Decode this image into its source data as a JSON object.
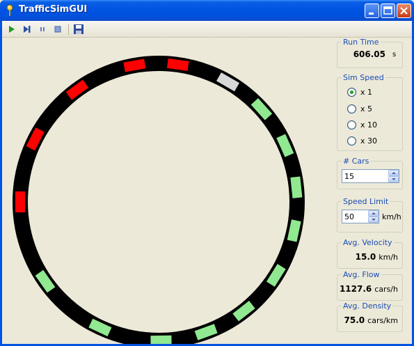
{
  "window": {
    "title": "TrafficSimGUI",
    "icon": "pin-icon"
  },
  "toolbar": {
    "items": [
      {
        "name": "play",
        "icon": "play-icon"
      },
      {
        "name": "step",
        "icon": "step-forward-icon"
      },
      {
        "name": "pause",
        "icon": "pause-icon"
      },
      {
        "name": "stop",
        "icon": "stop-icon"
      },
      {
        "name": "save",
        "icon": "save-icon"
      }
    ]
  },
  "colors": {
    "road": "#000000",
    "car_fast": "#90e890",
    "car_slow": "#ff0000",
    "car_mid": "#d8d8d8",
    "background": "#ece9d8",
    "group_label": "#1a4cb4"
  },
  "track": {
    "cars": [
      {
        "angle_deg": -100,
        "state": "slow"
      },
      {
        "angle_deg": -82,
        "state": "slow"
      },
      {
        "angle_deg": -60,
        "state": "mid"
      },
      {
        "angle_deg": -42,
        "state": "fast"
      },
      {
        "angle_deg": -24,
        "state": "fast"
      },
      {
        "angle_deg": -6,
        "state": "fast"
      },
      {
        "angle_deg": 12,
        "state": "fast"
      },
      {
        "angle_deg": 32,
        "state": "fast"
      },
      {
        "angle_deg": 52,
        "state": "fast"
      },
      {
        "angle_deg": 70,
        "state": "fast"
      },
      {
        "angle_deg": 89,
        "state": "fast"
      },
      {
        "angle_deg": 115,
        "state": "fast"
      },
      {
        "angle_deg": 145,
        "state": "fast"
      },
      {
        "angle_deg": 180,
        "state": "slow"
      },
      {
        "angle_deg": 207,
        "state": "slow"
      },
      {
        "angle_deg": 234,
        "state": "slow"
      }
    ]
  },
  "run_time": {
    "label": "Run Time",
    "value": "606.05",
    "unit": "s"
  },
  "sim_speed": {
    "label": "Sim Speed",
    "options": [
      "x 1",
      "x 5",
      "x 10",
      "x 30"
    ],
    "selected": "x 1"
  },
  "num_cars": {
    "label": "# Cars",
    "value": "15"
  },
  "speed_limit": {
    "label": "Speed Limit",
    "value": "50",
    "unit": "km/h"
  },
  "avg_velocity": {
    "label": "Avg. Velocity",
    "value": "15.0",
    "unit": "km/h"
  },
  "avg_flow": {
    "label": "Avg. Flow",
    "value": "1127.6",
    "unit": "cars/h"
  },
  "avg_density": {
    "label": "Avg. Density",
    "value": "75.0",
    "unit": "cars/km"
  }
}
